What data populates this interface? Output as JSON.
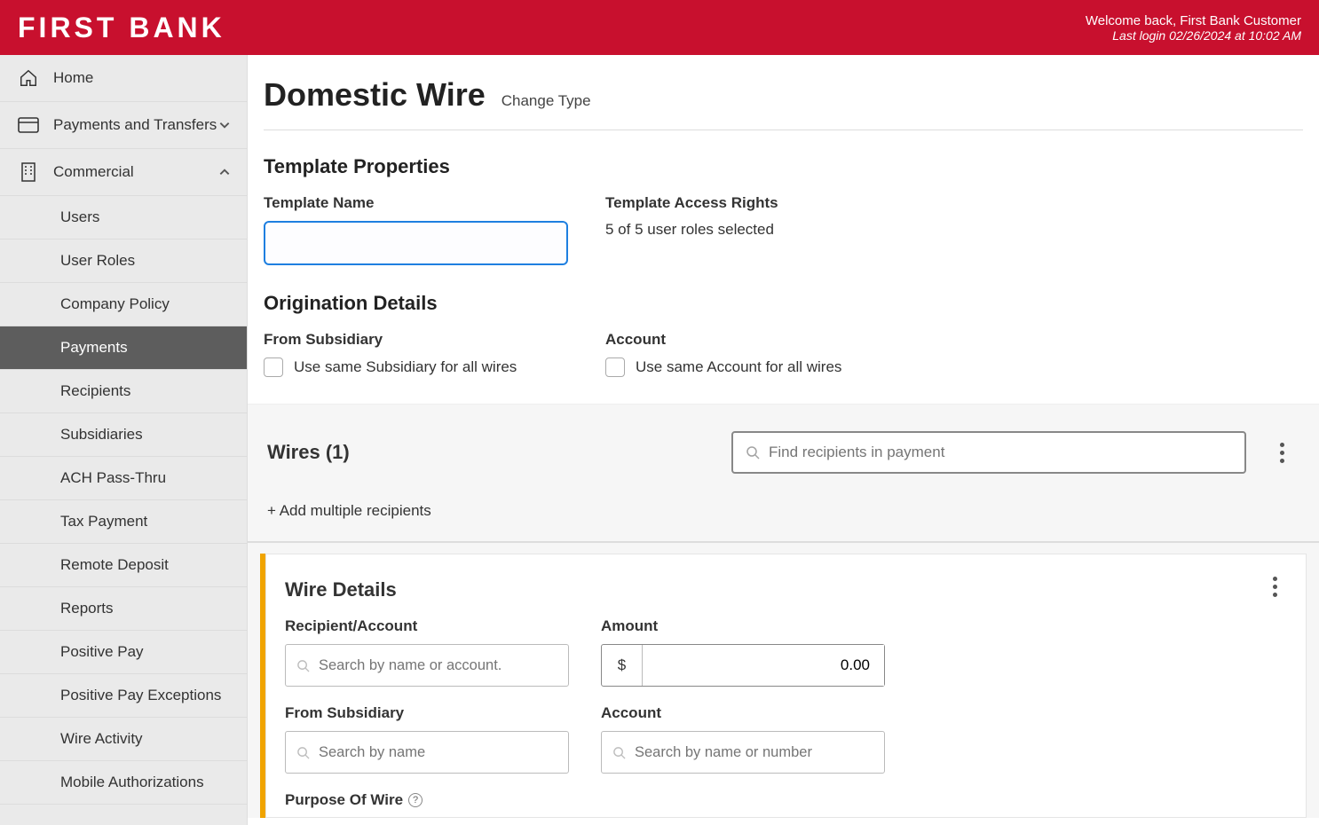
{
  "header": {
    "logo": "FIRST BANK",
    "welcome": "Welcome back, First Bank Customer",
    "last_login": "Last login 02/26/2024 at 10:02 AM"
  },
  "sidebar": {
    "home": "Home",
    "payments_transfers": "Payments and Transfers",
    "commercial": "Commercial",
    "items": [
      "Users",
      "User Roles",
      "Company Policy",
      "Payments",
      "Recipients",
      "Subsidiaries",
      "ACH Pass-Thru",
      "Tax Payment",
      "Remote Deposit",
      "Reports",
      "Positive Pay",
      "Positive Pay Exceptions",
      "Wire Activity",
      "Mobile Authorizations"
    ],
    "selected_index": 3
  },
  "page": {
    "title": "Domestic Wire",
    "change_type": "Change Type"
  },
  "template_props": {
    "heading": "Template Properties",
    "name_label": "Template Name",
    "name_value": "",
    "access_label": "Template Access Rights",
    "access_text": "5 of 5 user roles selected"
  },
  "origination": {
    "heading": "Origination Details",
    "from_sub_label": "From Subsidiary",
    "same_sub_label": "Use same Subsidiary for all wires",
    "account_label": "Account",
    "same_acct_label": "Use same Account for all wires"
  },
  "wires": {
    "title": "Wires (1)",
    "search_placeholder": "Find recipients in payment",
    "add_multiple": "+ Add multiple recipients"
  },
  "wire_details": {
    "heading": "Wire Details",
    "recipient_label": "Recipient/Account",
    "recipient_placeholder": "Search by name or account.",
    "amount_label": "Amount",
    "currency": "$",
    "amount_value": "0.00",
    "from_sub_label": "From Subsidiary",
    "from_sub_placeholder": "Search by name",
    "account_label": "Account",
    "account_placeholder": "Search by name or number",
    "purpose_label": "Purpose Of Wire"
  }
}
